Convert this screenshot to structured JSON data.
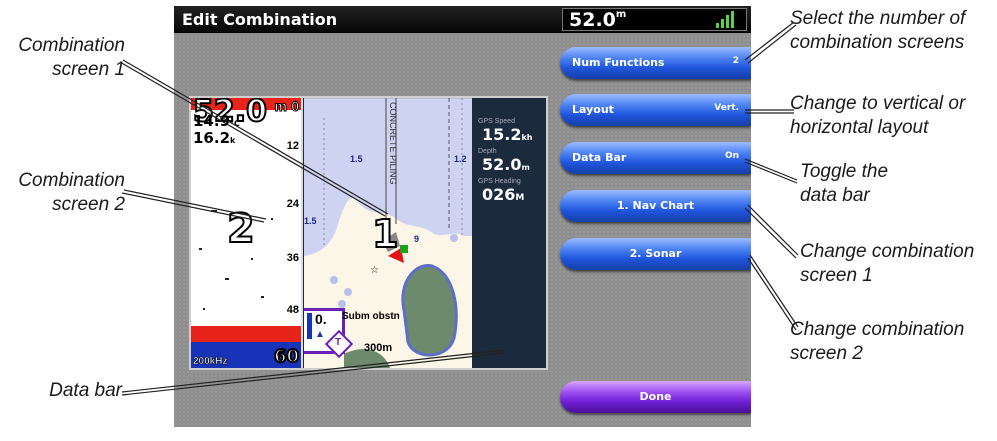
{
  "screen": {
    "title": "Edit Combination",
    "depth_value": "52.0",
    "depth_unit": "m"
  },
  "buttons": [
    {
      "label": "Num Functions",
      "value": "2"
    },
    {
      "label": "Layout",
      "value": "Vert."
    },
    {
      "label": "Data Bar",
      "value": "On"
    },
    {
      "label": "1. Nav Chart",
      "value": ""
    },
    {
      "label": "2. Sonar",
      "value": ""
    }
  ],
  "done_label": "Done",
  "sonar": {
    "depth_big": "52.0",
    "depth_unit": "m",
    "range_top": "0",
    "vals": [
      "14.9",
      "16.2"
    ],
    "val_units": [
      "°C",
      "k"
    ],
    "scale": [
      "12",
      "24",
      "36",
      "48",
      "60"
    ],
    "freq": "200kHz",
    "screen_number": "2"
  },
  "chart": {
    "labels": [
      "1.5",
      "1.2",
      "1.5",
      "9"
    ],
    "road": "CONCRETE PILING",
    "scale_value": "0.",
    "obstruction": "Subm obstn",
    "scale_dist": "300m",
    "screen_number": "1",
    "mark": "T"
  },
  "databar": {
    "items": [
      {
        "label": "GPS Speed",
        "value": "15.2",
        "unit": "kh"
      },
      {
        "label": "Depth",
        "value": "52.0",
        "unit": "m"
      },
      {
        "label": "GPS Heading",
        "value": "026",
        "unit": "M"
      }
    ]
  },
  "annotations": {
    "combo1": [
      "Combination",
      "screen 1"
    ],
    "combo2": [
      "Combination",
      "screen 2"
    ],
    "databar": "Data bar",
    "num_screens": [
      "Select the number of",
      "combination screens"
    ],
    "layout": [
      "Change to vertical or",
      "horizontal layout"
    ],
    "toggle": [
      "Toggle the",
      "data bar"
    ],
    "change1": [
      "Change combination",
      "screen 1"
    ],
    "change2": [
      "Change combination",
      "screen 2"
    ]
  }
}
